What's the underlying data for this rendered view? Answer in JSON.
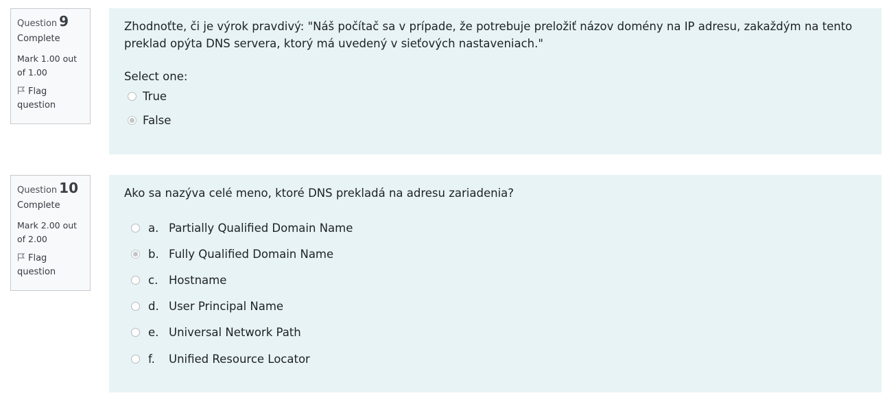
{
  "questions": [
    {
      "label": "Question",
      "number": "9",
      "state": "Complete",
      "grade": "Mark 1.00 out of 1.00",
      "flag_label": "Flag question",
      "text": "Zhodnoťte, či je výrok pravdivý: \"Náš počítač sa  v prípade, že potrebuje preložiť názov domény na IP adresu, zakaždým na tento preklad opýta DNS servera, ktorý má uvedený v sieťových nastaveniach.\"",
      "prompt": "Select one:",
      "options": [
        {
          "label": "True",
          "checked": false
        },
        {
          "label": "False",
          "checked": true
        }
      ]
    },
    {
      "label": "Question",
      "number": "10",
      "state": "Complete",
      "grade": "Mark 2.00 out of 2.00",
      "flag_label": "Flag question",
      "text": "Ako sa nazýva celé meno, ktoré DNS prekladá na adresu zariadenia?",
      "options": [
        {
          "letter": "a.",
          "label": "Partially Qualified Domain Name",
          "checked": false
        },
        {
          "letter": "b.",
          "label": "Fully Qualified Domain Name",
          "checked": true
        },
        {
          "letter": "c.",
          "label": "Hostname",
          "checked": false
        },
        {
          "letter": "d.",
          "label": "User Principal Name",
          "checked": false
        },
        {
          "letter": "e.",
          "label": "Universal Network Path",
          "checked": false
        },
        {
          "letter": "f.",
          "label": "Unified Resource Locator",
          "checked": false
        }
      ]
    }
  ],
  "colors": {
    "content_bg": "#e7f3f5",
    "info_bg": "#f8f9fa",
    "info_border": "#c6cacd"
  },
  "icons": {
    "flag": "flag-icon",
    "radio": "radio-button-icon"
  }
}
